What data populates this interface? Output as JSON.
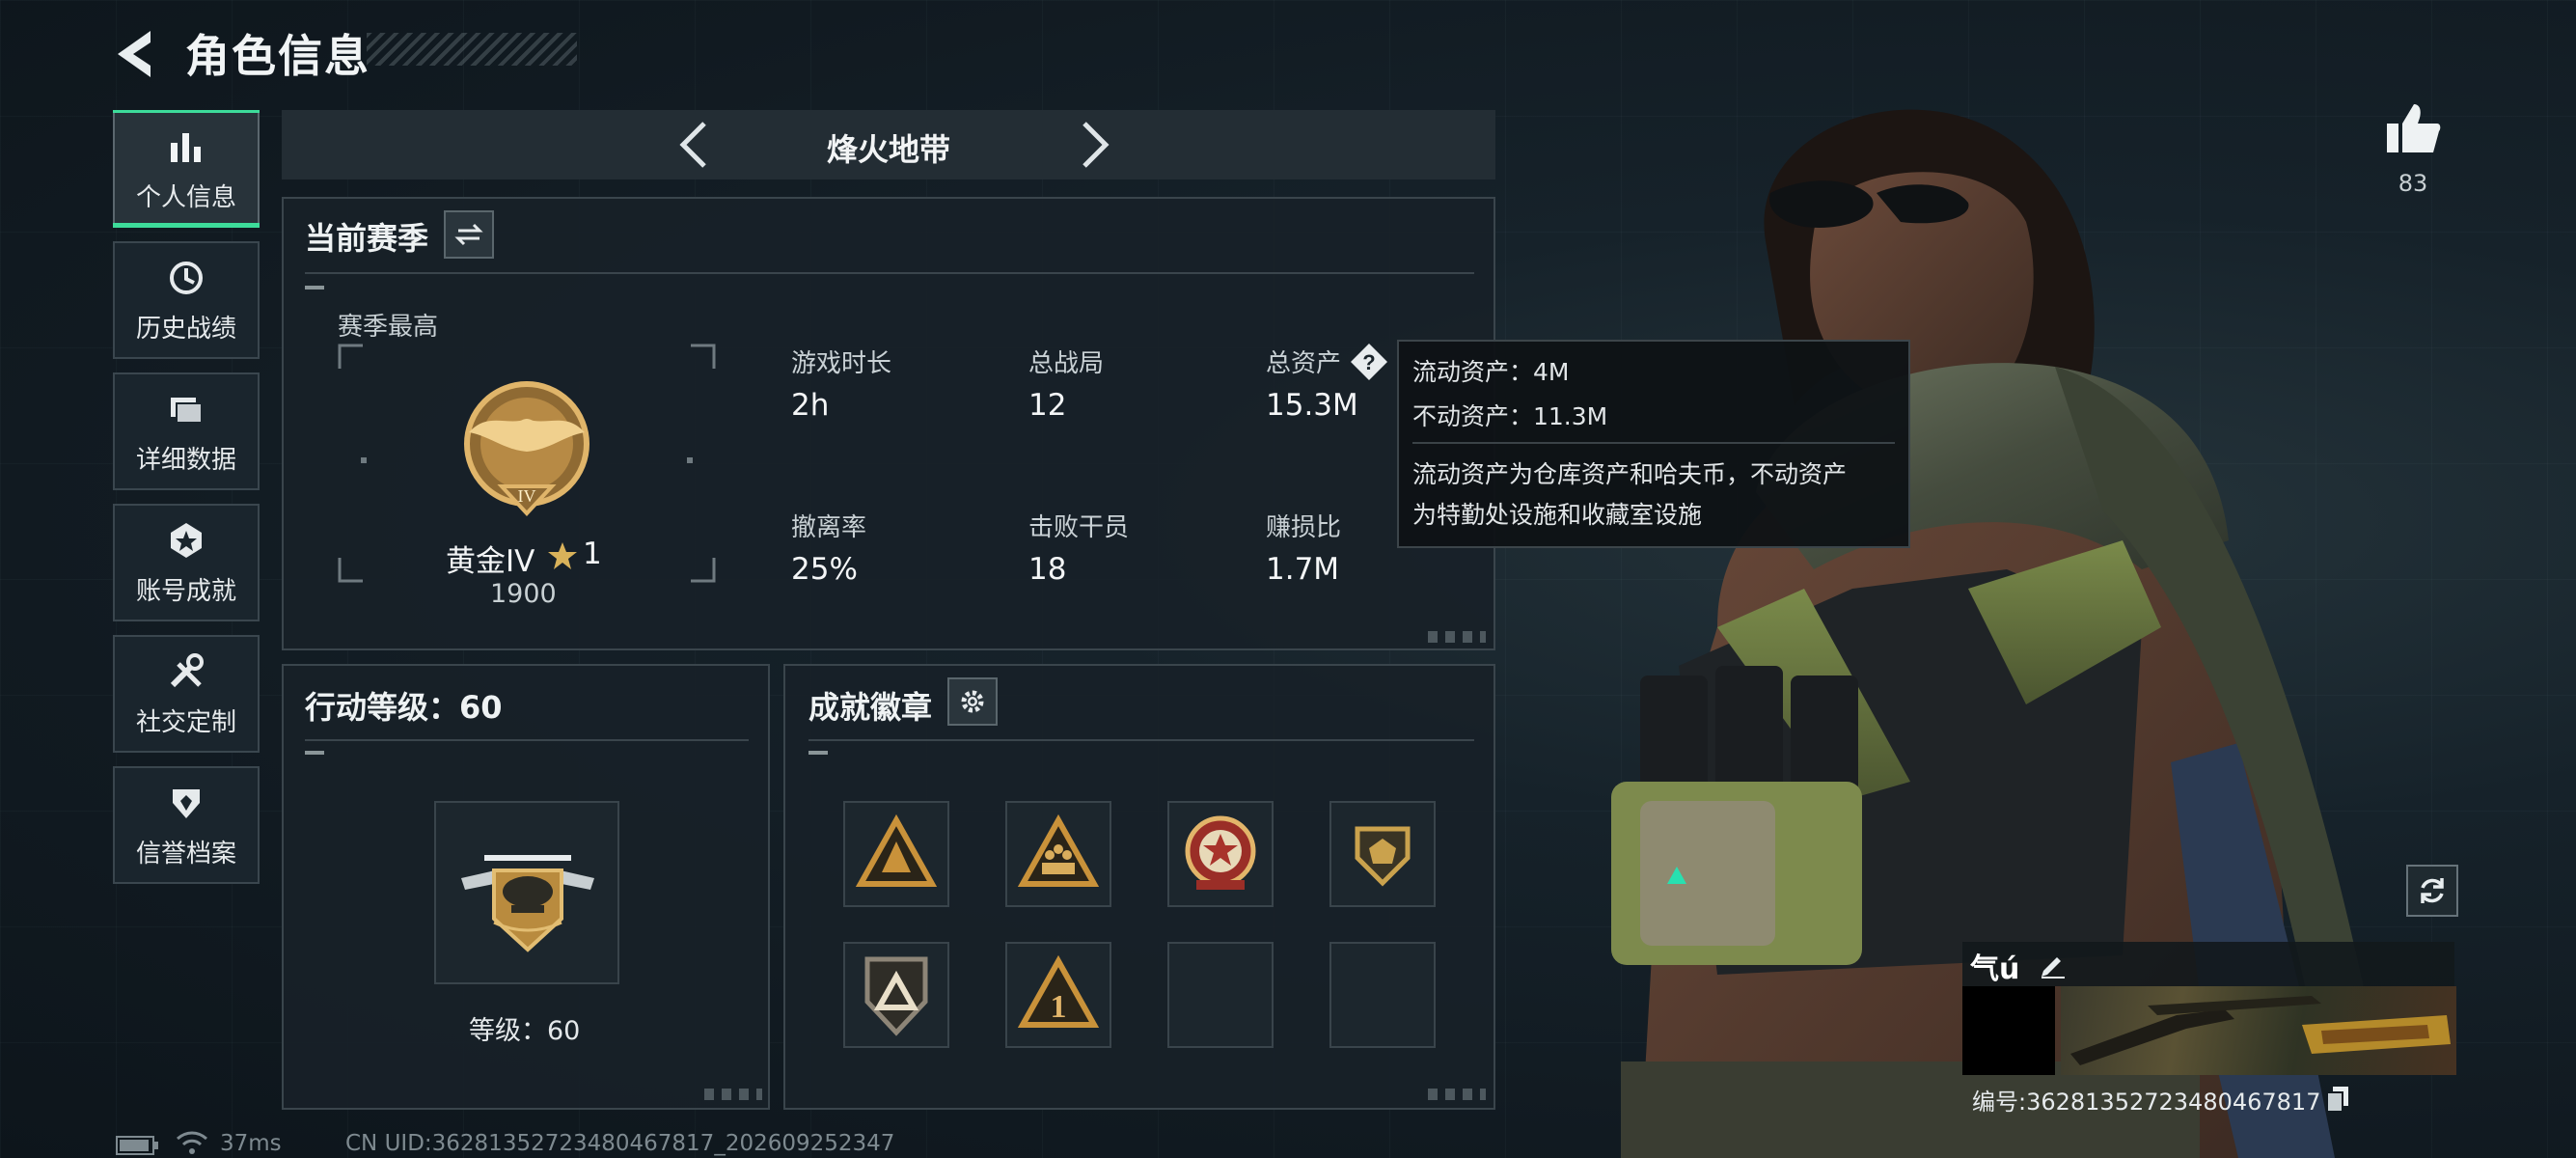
{
  "header": {
    "title": "角色信息"
  },
  "nav": [
    {
      "label": "个人信息",
      "icon": "bar-chart-icon",
      "active": true
    },
    {
      "label": "历史战绩",
      "icon": "history-clock-icon"
    },
    {
      "label": "详细数据",
      "icon": "folders-icon"
    },
    {
      "label": "账号成就",
      "icon": "achievement-star-icon"
    },
    {
      "label": "社交定制",
      "icon": "tools-icon"
    },
    {
      "label": "信誉档案",
      "icon": "shield-icon"
    }
  ],
  "mode": {
    "title": "烽火地带"
  },
  "season": {
    "title": "当前赛季",
    "best_label": "赛季最高",
    "rank_name": "黄金IV",
    "rank_stars": "1",
    "rank_points": "1900",
    "rank_numeral": "IV",
    "stats": [
      {
        "label": "游戏时长",
        "value": "2h"
      },
      {
        "label": "总战局",
        "value": "12"
      },
      {
        "label": "总资产",
        "value": "15.3M"
      },
      {
        "label": "撤离率",
        "value": "25%"
      },
      {
        "label": "击败干员",
        "value": "18"
      },
      {
        "label": "赚损比",
        "value": "1.7M"
      }
    ]
  },
  "tooltip": {
    "liquid": "流动资产：4M",
    "fixed": "不动资产：11.3M",
    "desc1": "流动资产为仓库资产和哈夫币，不动资产",
    "desc2": "为特勤处设施和收藏室设施"
  },
  "level": {
    "title": "行动等级：60",
    "caption": "等级：60"
  },
  "achievements": {
    "title": "成就徽章",
    "badges": [
      {
        "icon": "triangle-emblem-icon",
        "color": "#b8832e"
      },
      {
        "icon": "squad-triangle-icon",
        "color": "#b8832e"
      },
      {
        "icon": "star-medal-icon",
        "color": "#a8332b"
      },
      {
        "icon": "crest-shield-icon",
        "color": "#caa24d"
      },
      {
        "icon": "delta-shield-icon",
        "color": "#c9b89a"
      },
      {
        "icon": "number-one-triangle-icon",
        "color": "#b8832e"
      },
      {
        "icon": "empty-slot",
        "color": ""
      },
      {
        "icon": "empty-slot",
        "color": ""
      }
    ]
  },
  "profile": {
    "likes": "83",
    "name": "气ú",
    "id_line": "编号:3628135272348046781​7"
  },
  "status": {
    "ping": "37ms",
    "uid": "CN UID:3628135272348046781​7_202609252347"
  },
  "colors": {
    "accent": "#3ddc9a",
    "gold": "#c99a45"
  }
}
